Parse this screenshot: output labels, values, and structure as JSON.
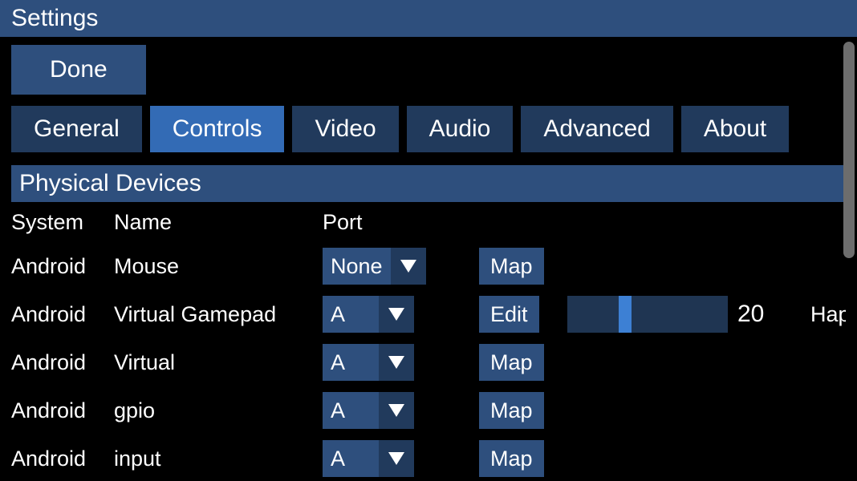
{
  "header": {
    "title": "Settings"
  },
  "done_label": "Done",
  "tabs": [
    {
      "label": "General",
      "active": false
    },
    {
      "label": "Controls",
      "active": true
    },
    {
      "label": "Video",
      "active": false
    },
    {
      "label": "Audio",
      "active": false
    },
    {
      "label": "Advanced",
      "active": false
    },
    {
      "label": "About",
      "active": false
    }
  ],
  "section_title": "Physical Devices",
  "columns": {
    "system": "System",
    "name": "Name",
    "port": "Port"
  },
  "action_labels": {
    "map": "Map",
    "edit": "Edit"
  },
  "devices": [
    {
      "system": "Android",
      "name": "Mouse",
      "port": "None",
      "action": "map"
    },
    {
      "system": "Android",
      "name": "Virtual Gamepad",
      "port": "A",
      "action": "edit",
      "slider_value": "20",
      "extra": "Hap"
    },
    {
      "system": "Android",
      "name": "Virtual",
      "port": "A",
      "action": "map"
    },
    {
      "system": "Android",
      "name": "gpio",
      "port": "A",
      "action": "map"
    },
    {
      "system": "Android",
      "name": "input",
      "port": "A",
      "action": "map"
    }
  ]
}
